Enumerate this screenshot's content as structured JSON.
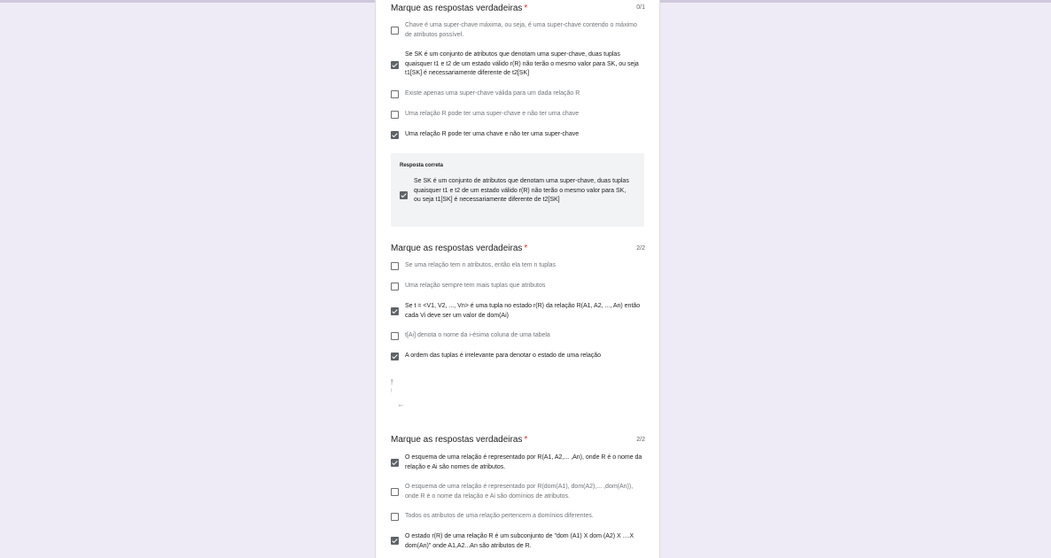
{
  "questions": [
    {
      "title": "Marque as respostas verdadeiras",
      "required_mark": "*",
      "score": "0/1",
      "options": [
        {
          "text": "Chave é uma super-chave máxima, ou seja, é uma super-chave contendo o máximo de atributos possível.",
          "checked": false
        },
        {
          "text": "Se SK é um conjunto de atributos que denotam uma super-chave, duas tuplas quaisquer t1 e t2 de um estado válido r(R) não terão o mesmo valor para SK, ou seja t1[SK] é necessariamente diferente de t2[SK]",
          "checked": true
        },
        {
          "text": "Existe apenas uma super-chave válida para um dada relação R",
          "checked": false
        },
        {
          "text": "Uma relação R pode ter uma super-chave e não ter uma chave",
          "checked": false
        },
        {
          "text": "Uma relação R pode ter uma chave e não ter uma super-chave",
          "checked": true
        }
      ],
      "correct_answer": {
        "label": "Resposta correta",
        "text": "Se SK é um conjunto de atributos que denotam uma super-chave, duas tuplas quaisquer t1 e t2 de um estado válido r(R) não terão o mesmo valor para SK, ou seja t1[SK] é necessariamente diferente de t2[SK]",
        "checked": true
      }
    },
    {
      "title": "Marque as respostas verdadeiras",
      "required_mark": "*",
      "score": "2/2",
      "options": [
        {
          "text": "Se uma relação tem n atributos, então ela tem n tuplas",
          "checked": false
        },
        {
          "text": "Uma relação sempre tem mais tuplas que atributos",
          "checked": false
        },
        {
          "text": "Se t = <V1, V2, ..., Vn> é uma tupla no estado r(R) da relação R(A1, A2, ..., An) então cada Vi deve ser um valor de dom(Ai)",
          "checked": true
        },
        {
          "text": "t[Ai] denota o nome da i-ésima coluna de uma tabela",
          "checked": false
        },
        {
          "text": "A ordem das tuplas é irrelevante para denotar o estado de uma relação",
          "checked": true
        }
      ]
    },
    {
      "title": "Marque as respostas verdadeiras",
      "required_mark": "*",
      "score": "2/2",
      "options": [
        {
          "text": "O esquema de uma relação é representado por R(A1, A2,... ,An), onde R é o nome da relação e Ai são nomes de atributos.",
          "checked": true
        },
        {
          "text": "O esquema de uma relação é representado por R(dom(A1), dom(A2),... ,dom(An)), onde R é o nome da relação e Ai são domínios de atributos.",
          "checked": false
        },
        {
          "text": "Todos os atributos de uma relação pertencem a domínios diferentes.",
          "checked": false
        },
        {
          "text": "O estado r(R) de uma relação R é um subconjunto de \"dom (A1) X dom (A2) X ....X dom(An)\" onde A1,A2...An são atributos de R.",
          "checked": true
        }
      ]
    }
  ],
  "stray_marks": [
    "!",
    "!",
    "'ik+·"
  ]
}
